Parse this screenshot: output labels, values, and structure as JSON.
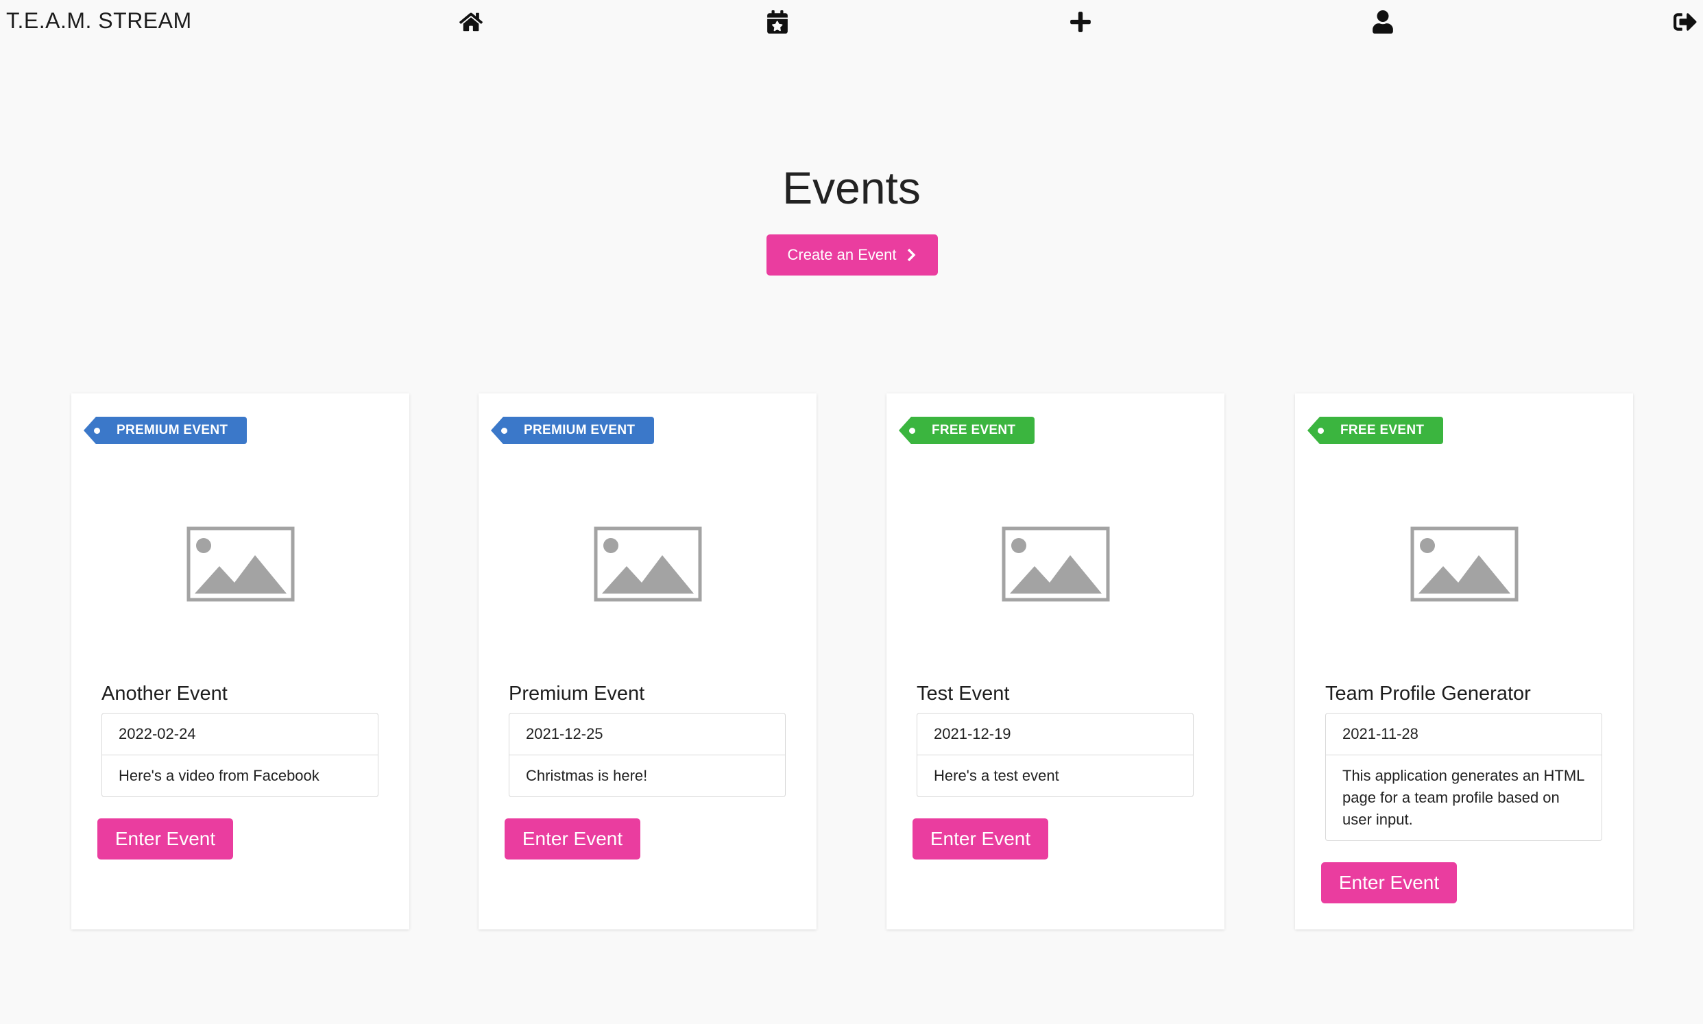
{
  "app": {
    "brand": "T.E.A.M. STREAM"
  },
  "nav": {
    "items": [
      {
        "name": "home-icon"
      },
      {
        "name": "calendar-star-icon"
      },
      {
        "name": "plus-icon"
      },
      {
        "name": "user-icon"
      },
      {
        "name": "sign-out-icon"
      }
    ]
  },
  "page": {
    "title": "Events",
    "create_button": "Create an Event"
  },
  "colors": {
    "accent": "#ea3d9f",
    "premium": "#3b78c9",
    "free": "#3bb53f",
    "background": "#f9f9f9"
  },
  "events": [
    {
      "badge": "PREMIUM EVENT",
      "badge_type": "premium",
      "title": "Another Event",
      "date": "2022-02-24",
      "description": "Here's a video from Facebook",
      "button": "Enter Event"
    },
    {
      "badge": "PREMIUM EVENT",
      "badge_type": "premium",
      "title": "Premium Event",
      "date": "2021-12-25",
      "description": "Christmas is here!",
      "button": "Enter Event"
    },
    {
      "badge": "FREE EVENT",
      "badge_type": "free",
      "title": "Test Event",
      "date": "2021-12-19",
      "description": "Here's a test event",
      "button": "Enter Event"
    },
    {
      "badge": "FREE EVENT",
      "badge_type": "free",
      "title": "Team Profile Generator",
      "date": "2021-11-28",
      "description": "This application generates an HTML page for a team profile based on user input.",
      "button": "Enter Event"
    }
  ]
}
